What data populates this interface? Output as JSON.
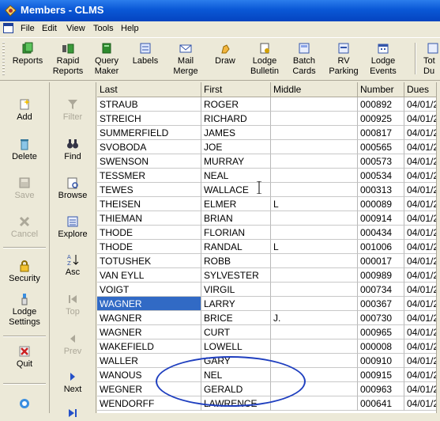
{
  "window": {
    "title": "Members - CLMS"
  },
  "menu": [
    "File",
    "Edit",
    "View",
    "Tools",
    "Help"
  ],
  "toolbar": [
    {
      "label1": "Reports",
      "label2": "",
      "icon": "reports-icon"
    },
    {
      "label1": "Rapid",
      "label2": "Reports",
      "icon": "rapid-reports-icon"
    },
    {
      "label1": "Query",
      "label2": "Maker",
      "icon": "query-maker-icon"
    },
    {
      "label1": "Labels",
      "label2": "",
      "icon": "labels-icon"
    },
    {
      "label1": "Mail",
      "label2": "Merge",
      "icon": "mail-merge-icon"
    },
    {
      "label1": "Draw",
      "label2": "",
      "icon": "draw-icon"
    },
    {
      "label1": "Lodge",
      "label2": "Bulletin",
      "icon": "lodge-bulletin-icon"
    },
    {
      "label1": "Batch",
      "label2": "Cards",
      "icon": "batch-cards-icon"
    },
    {
      "label1": "RV",
      "label2": "Parking",
      "icon": "rv-parking-icon"
    },
    {
      "label1": "Lodge",
      "label2": "Events",
      "icon": "lodge-events-icon"
    },
    {
      "label1": "Tot",
      "label2": "Du",
      "icon": "totals-icon"
    }
  ],
  "sidebar_left": [
    {
      "label1": "Add",
      "label2": "",
      "icon": "add-icon",
      "enabled": true
    },
    {
      "label1": "Delete",
      "label2": "",
      "icon": "delete-icon",
      "enabled": true
    },
    {
      "label1": "Save",
      "label2": "",
      "icon": "save-icon",
      "enabled": false
    },
    {
      "label1": "Cancel",
      "label2": "",
      "icon": "cancel-icon",
      "enabled": false
    },
    {
      "label1": "Security",
      "label2": "",
      "icon": "lock-icon",
      "enabled": true
    },
    {
      "label1": "Lodge",
      "label2": "Settings",
      "icon": "lodge-settings-icon",
      "enabled": true
    },
    {
      "label1": "Quit",
      "label2": "",
      "icon": "quit-icon",
      "enabled": true
    }
  ],
  "sidebar_right": [
    {
      "label": "Filter",
      "icon": "filter-icon",
      "enabled": false
    },
    {
      "label": "Find",
      "icon": "binoculars-icon",
      "enabled": true
    },
    {
      "label": "Browse",
      "icon": "browse-icon",
      "enabled": true
    },
    {
      "label": "Explore",
      "icon": "explore-icon",
      "enabled": true
    },
    {
      "label": "Asc",
      "icon": "sort-asc-icon",
      "enabled": true
    },
    {
      "label": "Top",
      "icon": "first-record-icon",
      "enabled": false
    },
    {
      "label": "Prev",
      "icon": "prev-icon",
      "enabled": false
    },
    {
      "label": "Next",
      "icon": "next-icon",
      "enabled": true
    }
  ],
  "grid": {
    "columns": [
      "Last",
      "First",
      "Middle",
      "Number",
      "Dues"
    ],
    "rows": [
      [
        "STRAUB",
        "ROGER",
        "",
        "000892",
        "04/01/2"
      ],
      [
        "STREICH",
        "RICHARD",
        "",
        "000925",
        "04/01/2"
      ],
      [
        "SUMMERFIELD",
        "JAMES",
        "",
        "000817",
        "04/01/2"
      ],
      [
        "SVOBODA",
        "JOE",
        "",
        "000565",
        "04/01/2"
      ],
      [
        "SWENSON",
        "MURRAY",
        "",
        "000573",
        "04/01/2"
      ],
      [
        "TESSMER",
        "NEAL",
        "",
        "000534",
        "04/01/2"
      ],
      [
        "TEWES",
        "WALLACE",
        "",
        "000313",
        "04/01/2"
      ],
      [
        "THEISEN",
        "ELMER",
        "L",
        "000089",
        "04/01/2"
      ],
      [
        "THIEMAN",
        "BRIAN",
        "",
        "000914",
        "04/01/2"
      ],
      [
        "THODE",
        "FLORIAN",
        "",
        "000434",
        "04/01/2"
      ],
      [
        "THODE",
        "RANDAL",
        "L",
        "001006",
        "04/01/2"
      ],
      [
        "TOTUSHEK",
        "ROBB",
        "",
        "000017",
        "04/01/2"
      ],
      [
        "VAN EYLL",
        "SYLVESTER",
        "",
        "000989",
        "04/01/2"
      ],
      [
        "VOIGT",
        "VIRGIL",
        "",
        "000734",
        "04/01/2"
      ],
      [
        "WAGNER",
        "LARRY",
        "",
        "000367",
        "04/01/2"
      ],
      [
        "WAGNER",
        "BRICE",
        "J.",
        "000730",
        "04/01/2"
      ],
      [
        "WAGNER",
        "CURT",
        "",
        "000965",
        "04/01/2"
      ],
      [
        "WAKEFIELD",
        "LOWELL",
        "",
        "000008",
        "04/01/2"
      ],
      [
        "WALLER",
        "GARY",
        "",
        "000910",
        "04/01/2"
      ],
      [
        "WANOUS",
        "NEL",
        "",
        "000915",
        "04/01/2"
      ],
      [
        "WEGNER",
        "GERALD",
        "",
        "000963",
        "04/01/2"
      ],
      [
        "WENDORFF",
        "LAWRENCE",
        "",
        "000641",
        "04/01/2"
      ]
    ],
    "selected_row": 14
  }
}
